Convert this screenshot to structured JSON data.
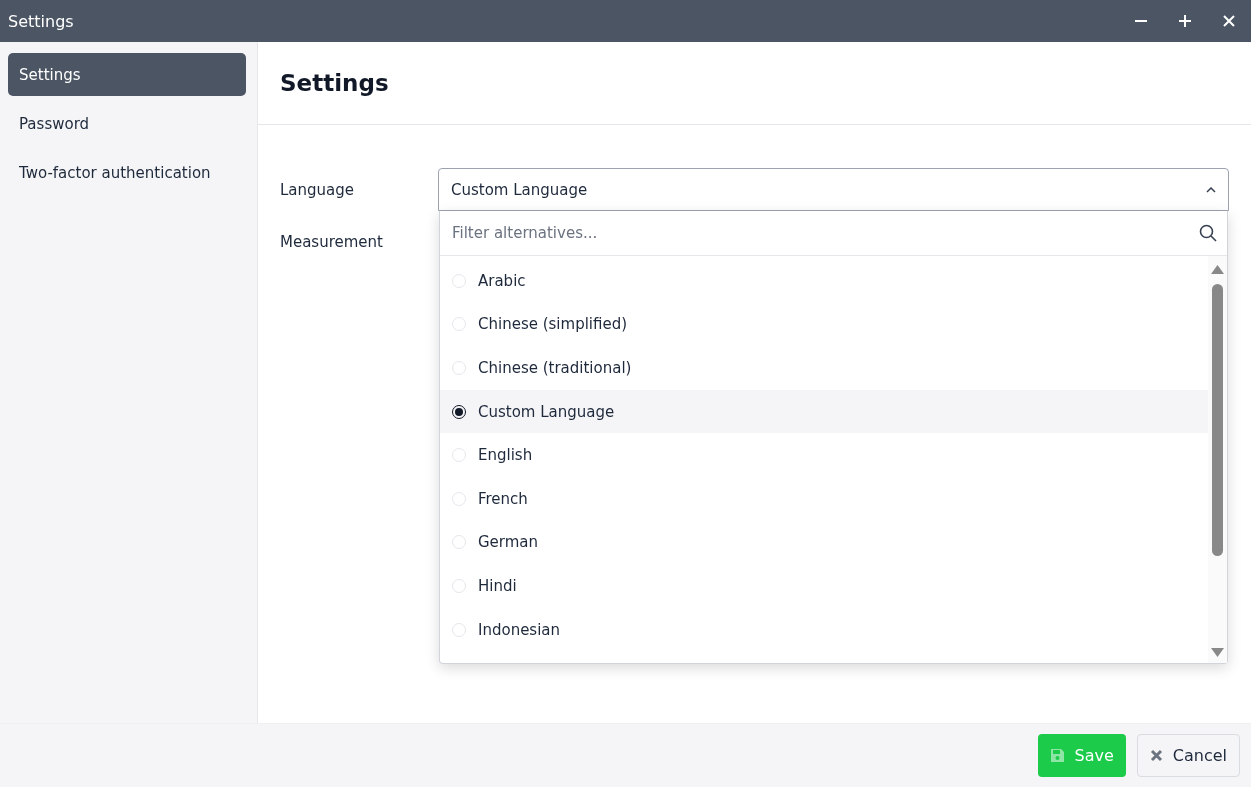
{
  "window": {
    "title": "Settings"
  },
  "sidebar": {
    "items": [
      {
        "label": "Settings",
        "selected": true
      },
      {
        "label": "Password",
        "selected": false
      },
      {
        "label": "Two-factor authentication",
        "selected": false
      }
    ]
  },
  "page": {
    "title": "Settings"
  },
  "form": {
    "language": {
      "label": "Language",
      "value": "Custom Language",
      "expanded": true,
      "filter": {
        "placeholder": "Filter alternatives..."
      },
      "options": [
        {
          "label": "Arabic",
          "selected": false
        },
        {
          "label": "Chinese (simplified)",
          "selected": false
        },
        {
          "label": "Chinese (traditional)",
          "selected": false
        },
        {
          "label": "Custom Language",
          "selected": true
        },
        {
          "label": "English",
          "selected": false
        },
        {
          "label": "French",
          "selected": false
        },
        {
          "label": "German",
          "selected": false
        },
        {
          "label": "Hindi",
          "selected": false
        },
        {
          "label": "Indonesian",
          "selected": false
        }
      ]
    },
    "measurement": {
      "label": "Measurement"
    }
  },
  "footer": {
    "buttons": [
      {
        "label": "Save",
        "kind": "primary"
      },
      {
        "label": "Cancel",
        "kind": "secondary"
      }
    ]
  }
}
